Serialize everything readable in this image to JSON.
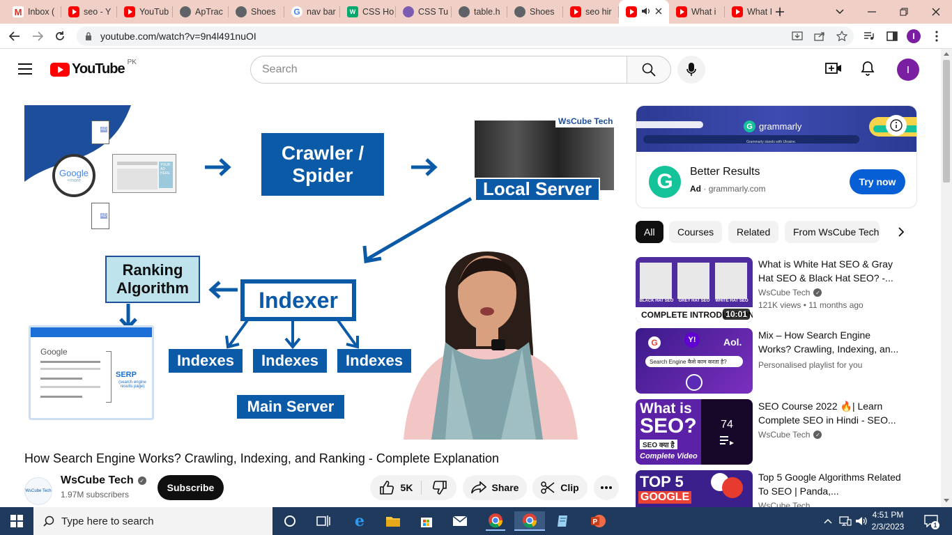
{
  "browser": {
    "tabs": [
      {
        "label": "Inbox (",
        "icon": "gmail-icon"
      },
      {
        "label": "seo - Y",
        "icon": "youtube-icon"
      },
      {
        "label": "YouTub",
        "icon": "youtube-icon"
      },
      {
        "label": "ApTrac",
        "icon": "globe-icon"
      },
      {
        "label": "Shoes",
        "icon": "globe-icon"
      },
      {
        "label": "nav bar",
        "icon": "google-icon"
      },
      {
        "label": "CSS Ho",
        "icon": "w3schools-icon"
      },
      {
        "label": "CSS Tu",
        "icon": "css-tutorial-icon"
      },
      {
        "label": "table.h",
        "icon": "globe-icon"
      },
      {
        "label": "Shoes",
        "icon": "globe-icon"
      },
      {
        "label": "seo hir",
        "icon": "youtube-icon"
      },
      {
        "label": "",
        "icon": "youtube-icon",
        "active": true
      },
      {
        "label": "What i",
        "icon": "youtube-icon"
      },
      {
        "label": "What I",
        "icon": "youtube-icon"
      }
    ],
    "url": "youtube.com/watch?v=9n4l491nuOI",
    "profile_initial": "I"
  },
  "youtube": {
    "logo": "YouTube",
    "country_code": "PK",
    "search_placeholder": "Search",
    "avatar_initial": "I"
  },
  "video": {
    "title": "How Search Engine Works? Crawling, Indexing, and Ranking - Complete Explanation",
    "channel": "WsCube Tech",
    "subscribers": "1.97M subscribers",
    "subscribe_label": "Subscribe",
    "likes": "5K",
    "share_label": "Share",
    "clip_label": "Clip",
    "thumbnail": {
      "crawler": "Crawler / Spider",
      "local_server": "Local Server",
      "ranking": "Ranking Algorithm",
      "indexer": "Indexer",
      "indexes": [
        "Indexes",
        "Indexes",
        "Indexes"
      ],
      "main_server": "Main Server",
      "google": "Google",
      "google_sub": "+more",
      "serp": "SERP",
      "serp_sub": "(search engine results page)",
      "ad_label": "AD",
      "your_ad": "YOUR AD HERE",
      "brand": "WsCube Tech"
    }
  },
  "ad": {
    "brand": "grammarly",
    "tagline": "Grammarly stands with Ukraine.",
    "headline": "Better Results",
    "ad_label": "Ad",
    "domain": "grammarly.com",
    "cta": "Try now"
  },
  "chips": [
    "All",
    "Courses",
    "Related",
    "From WsCube Tech"
  ],
  "recommendations": [
    {
      "title": "What is White Hat SEO & Gray Hat SEO & Black Hat SEO? -...",
      "channel": "WsCube Tech",
      "meta": "121K views  • 11 months ago",
      "duration": "10:01",
      "thumb_labels": [
        "BLACK HAT SEO",
        "GREY HAT SEO",
        "WHITE HAT SEO"
      ],
      "thumb_caption": "COMPLETE INTRODUCTION"
    },
    {
      "title": "Mix – How Search Engine Works? Crawling, Indexing, an...",
      "channel": "Personalised playlist for you",
      "meta": "",
      "thumb_text": "Search Engine कैसे काम करता है?",
      "thumb_logo": "Aol."
    },
    {
      "title": "SEO Course 2022 🔥| Learn Complete SEO in Hindi - SEO...",
      "channel": "WsCube Tech",
      "meta": "",
      "playlist_count": "74",
      "thumb_lines": [
        "What is",
        "SEO?",
        "SEO क्या है",
        "Complete Video"
      ]
    },
    {
      "title": "Top 5 Google Algorithms Related To SEO | Panda,...",
      "channel": "WsCube Tech",
      "meta": "",
      "thumb_lines": [
        "TOP 5",
        "GOOGLE"
      ]
    }
  ],
  "taskbar": {
    "search_placeholder": "Type here to search",
    "time": "4:51 PM",
    "date": "2/3/2023",
    "notification_count": "1"
  }
}
